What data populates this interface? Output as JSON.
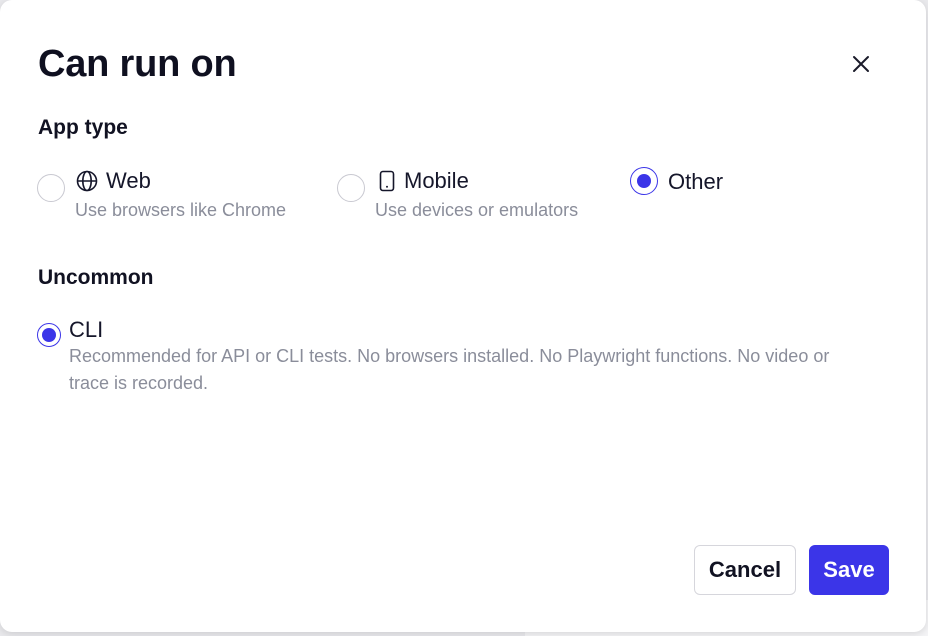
{
  "dialog": {
    "title": "Can run on",
    "close_icon": "close-icon"
  },
  "app_type": {
    "heading": "App type",
    "options": [
      {
        "label": "Web",
        "description": "Use browsers like Chrome",
        "icon": "globe-icon",
        "checked": false
      },
      {
        "label": "Mobile",
        "description": "Use devices or emulators",
        "icon": "mobile-phone-icon",
        "checked": false
      },
      {
        "label": "Other",
        "description": "",
        "icon": "",
        "checked": true
      }
    ]
  },
  "uncommon": {
    "heading": "Uncommon",
    "options": [
      {
        "label": "CLI",
        "description": "Recommended for API or CLI tests. No browsers installed. No Playwright functions. No video or trace is recorded.",
        "checked": true
      }
    ]
  },
  "footer": {
    "cancel_label": "Cancel",
    "save_label": "Save"
  },
  "colors": {
    "accent": "#3b35e8",
    "muted_text": "#8a8d9a"
  }
}
